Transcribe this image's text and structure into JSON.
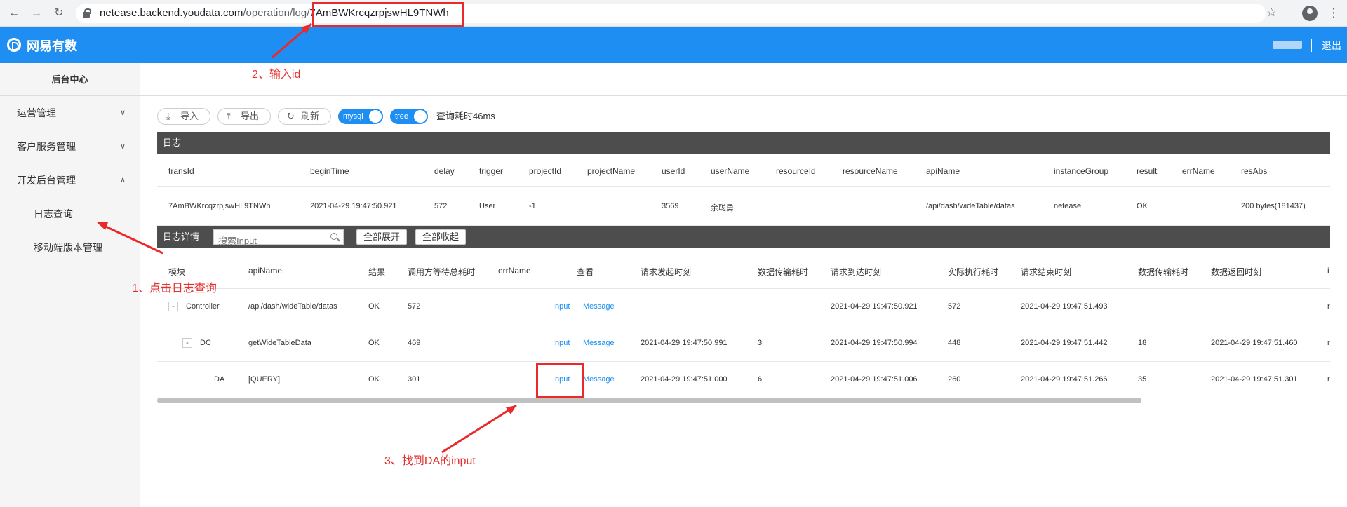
{
  "browser": {
    "url_host": "netease.backend.youdata.com",
    "url_path": "/operation/log/",
    "url_id": "7AmBWKrcqzrpjswHL9TNWh"
  },
  "header": {
    "brand": "网易有数",
    "logout": "退出",
    "accent_color": "#1e8ef2"
  },
  "sidebar": {
    "title": "后台中心",
    "items": [
      {
        "label": "运营管理",
        "chevron": "down"
      },
      {
        "label": "客户服务管理",
        "chevron": "down"
      },
      {
        "label": "开发后台管理",
        "chevron": "up"
      }
    ],
    "sub_items": [
      {
        "label": "日志查询"
      },
      {
        "label": "移动端版本管理"
      }
    ]
  },
  "toolbar": {
    "import_label": "导入",
    "export_label": "导出",
    "refresh_label": "刷新",
    "switch_mysql": "mysql",
    "switch_tree": "tree",
    "query_time": "查询耗时46ms"
  },
  "log": {
    "title": "日志",
    "columns": [
      "transId",
      "beginTime",
      "delay",
      "trigger",
      "projectId",
      "projectName",
      "userId",
      "userName",
      "resourceId",
      "resourceName",
      "apiName",
      "instanceGroup",
      "result",
      "errName",
      "resAbs"
    ],
    "row": [
      "7AmBWKrcqzrpjswHL9TNWh",
      "2021-04-29 19:47:50.921",
      "572",
      "User",
      "-1",
      "",
      "3569",
      "余聪勇",
      "",
      "",
      "/api/dash/wideTable/datas",
      "netease",
      "OK",
      "",
      "200 bytes(181437)"
    ]
  },
  "detail": {
    "title": "日志详情",
    "search_placeholder": "搜索Input",
    "expand_all": "全部展开",
    "collapse_all": "全部收起",
    "columns": [
      "模块",
      "apiName",
      "结果",
      "调用方等待总耗时",
      "errName",
      "查看",
      "请求发起时刻",
      "数据传输耗时",
      "请求到达时刻",
      "实际执行耗时",
      "请求结束时刻",
      "数据传输耗时",
      "数据返回时刻",
      "i"
    ],
    "rows": [
      {
        "expander": "-",
        "module": "Controller",
        "apiName": "/api/dash/wideTable/datas",
        "result": "OK",
        "wait": "572",
        "errName": "",
        "input": "Input",
        "message": "Message",
        "reqStart": "",
        "trans1": "",
        "reqArrive": "2021-04-29 19:47:50.921",
        "exec": "572",
        "reqEnd": "2021-04-29 19:47:51.493",
        "trans2": "",
        "ret": "",
        "tail": "r"
      },
      {
        "expander": "-",
        "module": "DC",
        "apiName": "getWideTableData",
        "result": "OK",
        "wait": "469",
        "errName": "",
        "input": "Input",
        "message": "Message",
        "reqStart": "2021-04-29 19:47:50.991",
        "trans1": "3",
        "reqArrive": "2021-04-29 19:47:50.994",
        "exec": "448",
        "reqEnd": "2021-04-29 19:47:51.442",
        "trans2": "18",
        "ret": "2021-04-29 19:47:51.460",
        "tail": "r"
      },
      {
        "expander": "",
        "module": "DA",
        "apiName": "[QUERY]",
        "result": "OK",
        "wait": "301",
        "errName": "",
        "input": "Input",
        "message": "Message",
        "reqStart": "2021-04-29 19:47:51.000",
        "trans1": "6",
        "reqArrive": "2021-04-29 19:47:51.006",
        "exec": "260",
        "reqEnd": "2021-04-29 19:47:51.266",
        "trans2": "35",
        "ret": "2021-04-29 19:47:51.301",
        "tail": "r"
      }
    ]
  },
  "annotations": {
    "step1": "1、点击日志查询",
    "step2": "2、输入id",
    "step3": "3、找到DA的input",
    "color": "#e53030"
  }
}
